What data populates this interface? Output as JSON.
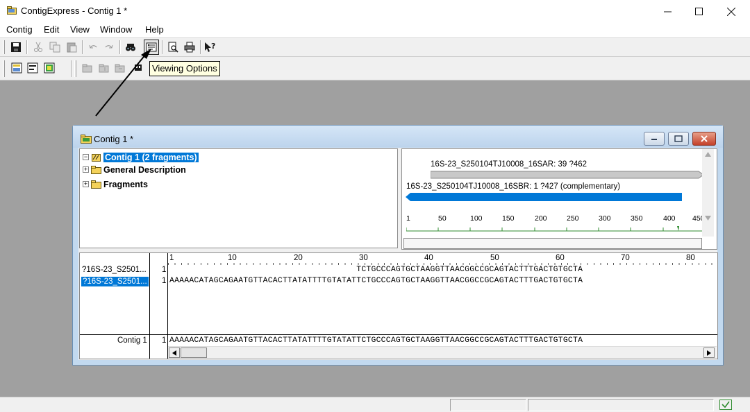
{
  "app": {
    "title": "ContigExpress - Contig 1 *"
  },
  "menu": [
    "Contig",
    "Edit",
    "View",
    "Window",
    "Help"
  ],
  "toolbar": {
    "tooltip": "Viewing Options"
  },
  "child": {
    "title": "Contig 1 *",
    "tree": {
      "root": "Contig 1 (2 fragments)",
      "items": [
        "General Description",
        "Fragments"
      ]
    },
    "map": {
      "fragment1_label": "16S-23_S250104TJ10008_16SAR: 39 ?462",
      "fragment2_label": "16S-23_S250104TJ10008_16SBR: 1 ?427 (complementary)",
      "ruler_ticks": [
        "1",
        "50",
        "100",
        "150",
        "200",
        "250",
        "300",
        "350",
        "400",
        "450"
      ]
    },
    "alignment": {
      "ruler_ticks": [
        "1",
        "10",
        "20",
        "30",
        "40",
        "50",
        "60",
        "70",
        "80"
      ],
      "rows": [
        {
          "name": "?16S-23_S2501...",
          "start": "1",
          "seq": "                                      TCTGCCCAGTGCTAAGGTTAACGGCCGCAGTACTTTGACTGTGCTA"
        },
        {
          "name": "?16S-23_S2501...",
          "start": "1",
          "seq": "AAAAACATAGCAGAATGTTACACTTATATTTTGTATATTCTGCCCAGTGCTAAGGTTAACGGCCGCAGTACTTTGACTGTGCTA"
        }
      ],
      "consensus": {
        "name": "Contig 1",
        "start": "1",
        "seq": "AAAAACATAGCAGAATGTTACACTTATATTTTGTATATTCTGCCCAGTGCTAAGGTTAACGGCCGCAGTACTTTGACTGTGCTA"
      }
    }
  },
  "colors": {
    "selection": "#0078d7",
    "fragment_reverse": "#0078d7",
    "fragment_forward": "#c8c8c8",
    "ruler_green": "#2e8b2e",
    "mdi_background": "#a0a0a0",
    "child_frame": "#c2d9ef"
  }
}
